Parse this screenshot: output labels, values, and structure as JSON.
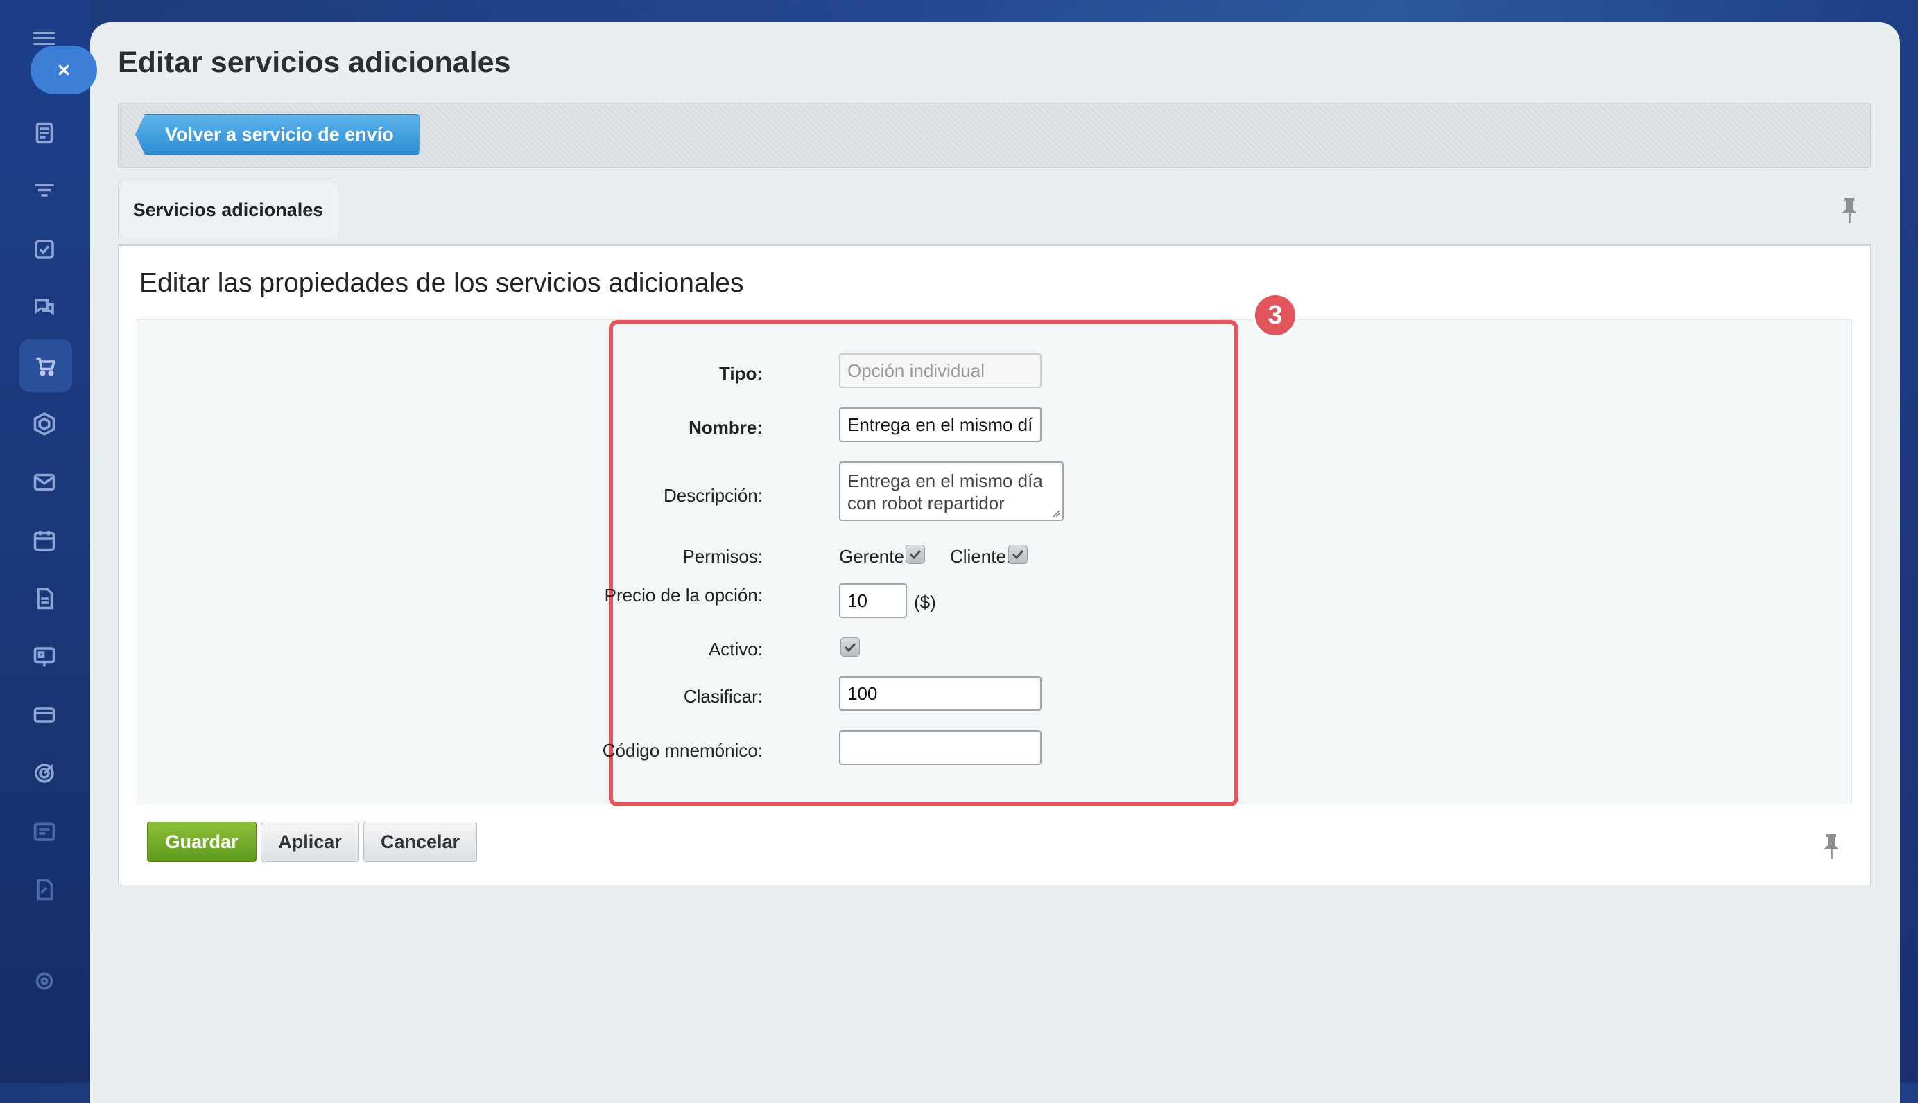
{
  "page": {
    "title": "Editar servicios adicionales",
    "back_button": "Volver a servicio de envío",
    "tab_label": "Servicios adicionales",
    "section_title": "Editar las propiedades de los servicios adicionales",
    "step_badge": "3"
  },
  "sidebar": {
    "icons": [
      "menu-icon",
      "close-icon",
      "news-icon",
      "filter-icon",
      "tasks-icon",
      "chat-icon",
      "cart-icon",
      "hexagon-icon",
      "mail-icon",
      "calendar-icon",
      "document-icon",
      "presentation-icon",
      "card-icon",
      "target-icon",
      "schedule-icon",
      "edit-document-icon",
      "settings-icon"
    ],
    "active": "cart-icon"
  },
  "form": {
    "tipo": {
      "label": "Tipo:",
      "value": "Opción individual"
    },
    "nombre": {
      "label": "Nombre:",
      "value": "Entrega en el mismo día"
    },
    "descripcion": {
      "label": "Descripción:",
      "value": "Entrega en el mismo día con robot repartidor"
    },
    "permisos": {
      "label": "Permisos:",
      "gerente_label": "Gerente:",
      "gerente_checked": true,
      "cliente_label": "Cliente:",
      "cliente_checked": true
    },
    "precio": {
      "label": "Precio de la opción:",
      "value": "10",
      "currency": "($)"
    },
    "activo": {
      "label": "Activo:",
      "checked": true
    },
    "clasificar": {
      "label": "Clasificar:",
      "value": "100"
    },
    "codigo": {
      "label": "Código mnemónico:",
      "value": ""
    }
  },
  "buttons": {
    "save": "Guardar",
    "apply": "Aplicar",
    "cancel": "Cancelar"
  },
  "colors": {
    "accent_blue": "#3d7fd6",
    "highlight_red": "#e2555c",
    "save_green": "#6ea826"
  }
}
